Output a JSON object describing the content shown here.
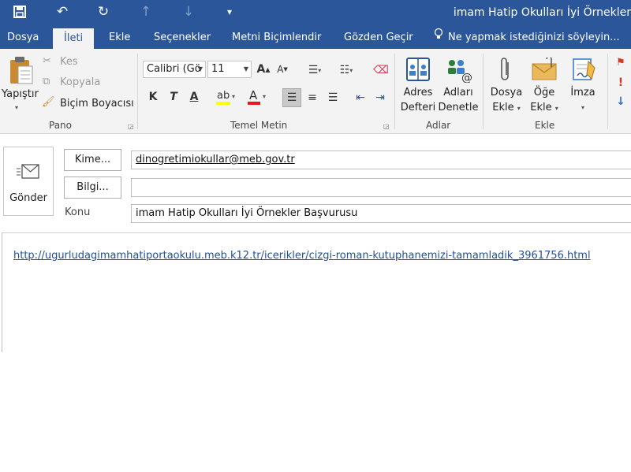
{
  "window": {
    "title": "imam Hatip Okulları İyi Örnekler"
  },
  "tabs": [
    {
      "id": "dosya",
      "label": "Dosya"
    },
    {
      "id": "ileti",
      "label": "İleti"
    },
    {
      "id": "ekle",
      "label": "Ekle"
    },
    {
      "id": "secenekler",
      "label": "Seçenekler"
    },
    {
      "id": "metni",
      "label": "Metni Biçimlendir"
    },
    {
      "id": "gozden",
      "label": "Gözden Geçir"
    }
  ],
  "tell_me": "Ne yapmak istediğinizi söyleyin...",
  "ribbon": {
    "pano": {
      "label": "Pano",
      "paste": "Yapıştır",
      "cut": "Kes",
      "copy": "Kopyala",
      "format_painter": "Biçim Boyacısı"
    },
    "temel_metin": {
      "label": "Temel Metin",
      "font_name": "Calibri (Gö",
      "font_size": "11",
      "bold": "K",
      "italic": "T",
      "underline": "A"
    },
    "adlar": {
      "label": "Adlar",
      "address_book_1": "Adres",
      "address_book_2": "Defteri",
      "check_names_1": "Adları",
      "check_names_2": "Denetle"
    },
    "ekle": {
      "label": "Ekle",
      "attach_file_1": "Dosya",
      "attach_file_2": "Ekle",
      "attach_item_1": "Öğe",
      "attach_item_2": "Ekle",
      "signature": "İmza"
    }
  },
  "compose": {
    "send": "Gönder",
    "to_button": "Kime...",
    "cc_button": "Bilgi...",
    "subject_label": "Konu",
    "to_value": "dinogretimiokullar@meb.gov.tr",
    "cc_value": "",
    "subject_value": "imam Hatip Okulları İyi Örnekler Başvurusu"
  },
  "body": {
    "link": "http://ugurludagimamhatiportaokulu.meb.k12.tr/icerikler/cizgi-roman-kutuphanemizi-tamamladik_3961756.html"
  },
  "colors": {
    "accent": "#2b579a",
    "ribbon": "#f3f3f3",
    "link": "#1f4e9a"
  }
}
